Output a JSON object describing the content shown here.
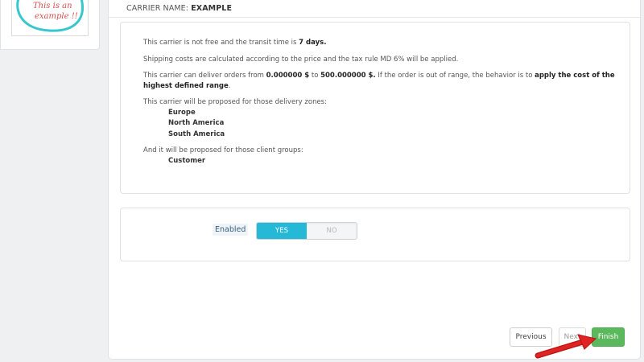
{
  "thumbnail": {
    "line1": "This is an",
    "line2": "example !!"
  },
  "carrier": {
    "header_label": "Carrier name:",
    "name": "EXAMPLE"
  },
  "summary": {
    "transit_pre": "This carrier is not free and the transit time is ",
    "transit_time": "7 days.",
    "shipping_costs": "Shipping costs are calculated according to the price and the tax rule MD 6% will be applied.",
    "range_pre": "This carrier can deliver orders from ",
    "range_min": "0.000000 $",
    "range_mid": " to ",
    "range_max": "500.000000 $.",
    "range_post": " If the order is out of range, the behavior is to ",
    "behavior_line1": "apply the cost of the",
    "behavior_line2": "highest defined range",
    "behavior_end": ".",
    "zones_intro": "This carrier will be proposed for those delivery zones:",
    "zones": [
      "Europe",
      "North America",
      "South America"
    ],
    "groups_intro": "And it will be proposed for those client groups:",
    "groups": [
      "Customer"
    ]
  },
  "status": {
    "label": "Enabled",
    "yes": "YES",
    "no": "NO",
    "selected": "YES"
  },
  "buttons": {
    "previous": "Previous",
    "next": "Next",
    "finish": "Finish"
  },
  "colors": {
    "accent": "#25b9d7",
    "finish": "#5cb85c",
    "annotation_arrow": "#e02424"
  }
}
